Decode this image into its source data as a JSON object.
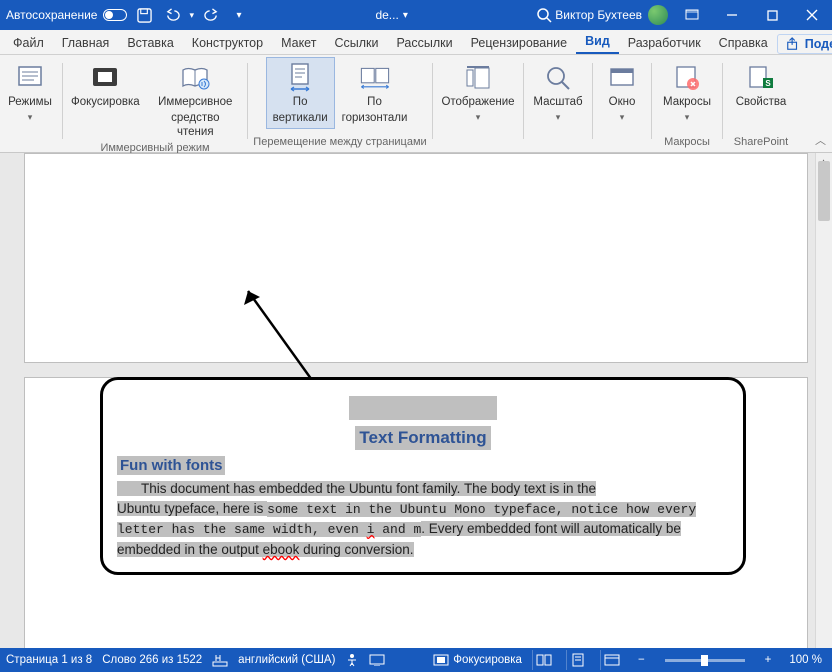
{
  "titlebar": {
    "autosave_label": "Автосохранение",
    "doc_name": "de...",
    "user_name": "Виктор Бухтеев"
  },
  "tabs": {
    "file": "Файл",
    "home": "Главная",
    "insert": "Вставка",
    "design": "Конструктор",
    "layout": "Макет",
    "references": "Ссылки",
    "mailings": "Рассылки",
    "review": "Рецензирование",
    "view": "Вид",
    "developer": "Разработчик",
    "help": "Справка",
    "share": "Поделиться"
  },
  "ribbon": {
    "modes": "Режимы",
    "focus": "Фокусировка",
    "immersive_reader_l1": "Иммерсивное",
    "immersive_reader_l2": "средство чтения",
    "group_immersive": "Иммерсивный режим",
    "vertical_l1": "По",
    "vertical_l2": "вертикали",
    "horizontal_l1": "По",
    "horizontal_l2": "горизонтали",
    "group_pagemove": "Перемещение между страницами",
    "display": "Отображение",
    "zoom": "Масштаб",
    "window": "Окно",
    "macros": "Макросы",
    "group_macros": "Макросы",
    "properties": "Свойства",
    "group_sp": "SharePoint"
  },
  "document": {
    "title": "Text Formatting",
    "h2": "Fun with fonts",
    "p1a": "This document has embedded the Ubuntu font family. The body text is in the",
    "p1b": "Ubuntu typeface, here is ",
    "p_mono": "some text in the Ubuntu Mono typeface, notice how every letter has the same width, even ",
    "p_i": "i",
    "p_and": " and ",
    "p_m": "m",
    "p1c": ". Every embedded font will automatically be embedded in the output ",
    "p_ebook": "ebook",
    "p1d": " during conversion."
  },
  "statusbar": {
    "page": "Страница 1 из 8",
    "words": "Слово 266 из 1522",
    "lang": "английский (США)",
    "focus": "Фокусировка",
    "zoom_minus": "−",
    "zoom_plus": "+",
    "zoom_pct": "100 %"
  }
}
